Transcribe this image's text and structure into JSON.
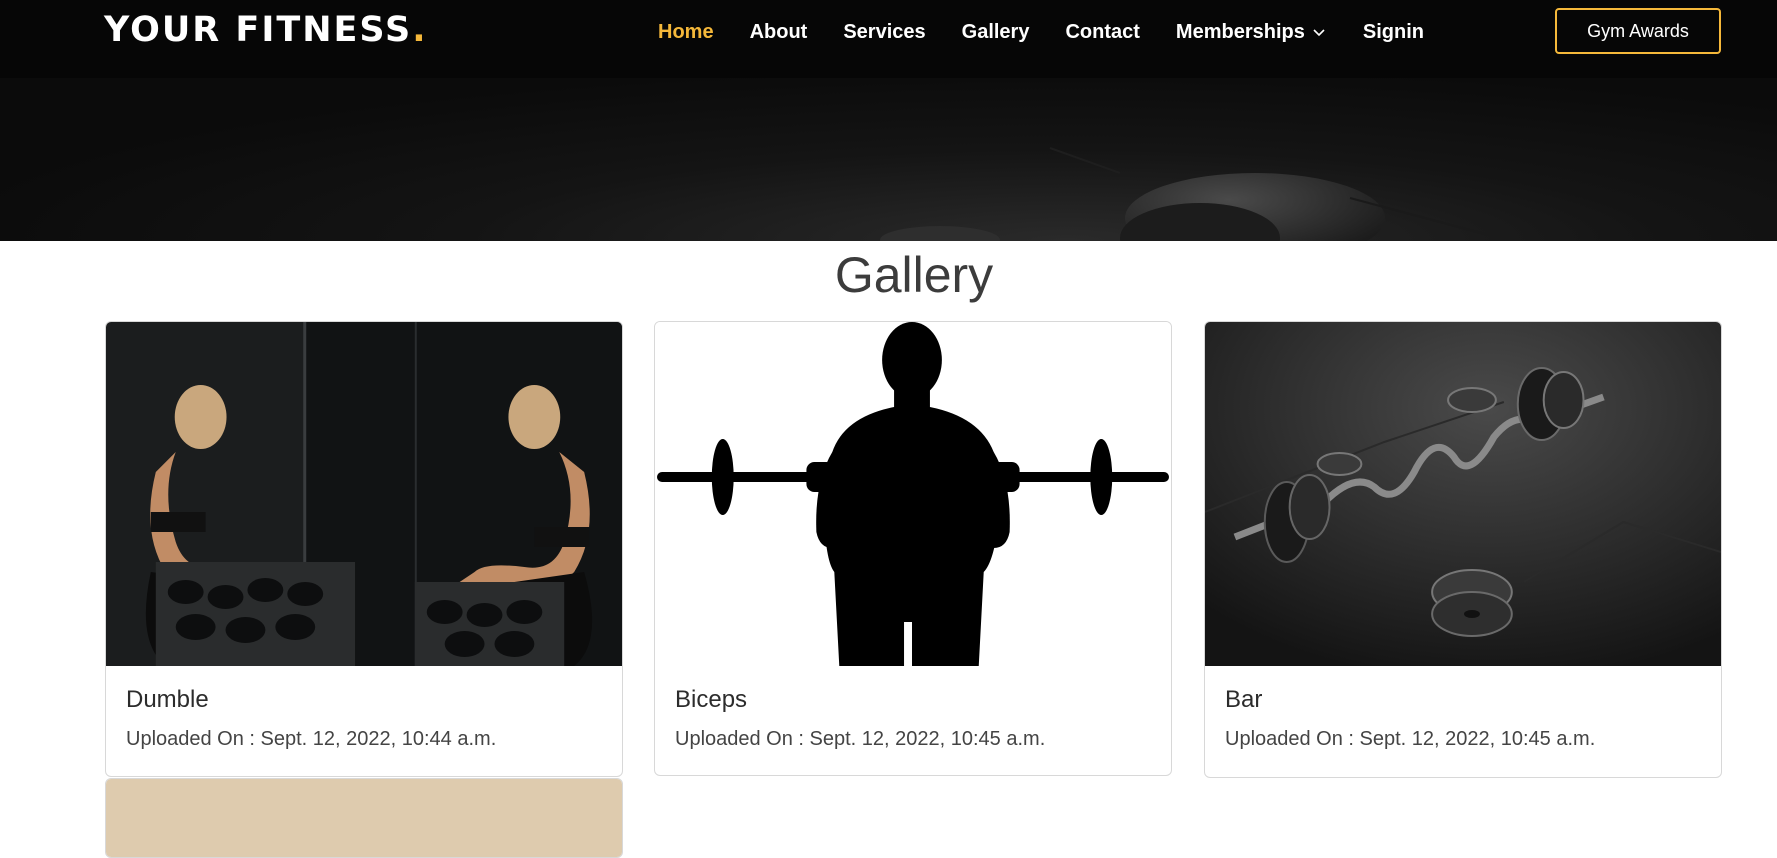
{
  "brand": {
    "name": "YOUR FITNESS",
    "dot": "."
  },
  "nav": {
    "items": [
      {
        "label": "Home",
        "active": true
      },
      {
        "label": "About"
      },
      {
        "label": "Services"
      },
      {
        "label": "Gallery"
      },
      {
        "label": "Contact"
      },
      {
        "label": "Memberships",
        "dropdown": true
      },
      {
        "label": "Signin"
      }
    ],
    "cta": "Gym Awards"
  },
  "gallery": {
    "title": "Gallery",
    "cards": [
      {
        "title": "Dumble",
        "uploaded": "Uploaded On : Sept. 12, 2022, 10:44 a.m."
      },
      {
        "title": "Biceps",
        "uploaded": "Uploaded On : Sept. 12, 2022, 10:45 a.m."
      },
      {
        "title": "Bar",
        "uploaded": "Uploaded On : Sept. 12, 2022, 10:45 a.m."
      }
    ]
  },
  "colors": {
    "accent": "#f5b83a",
    "nav_bg": "#060606"
  },
  "icons": {
    "memberships_dropdown": "chevron-down-icon"
  }
}
